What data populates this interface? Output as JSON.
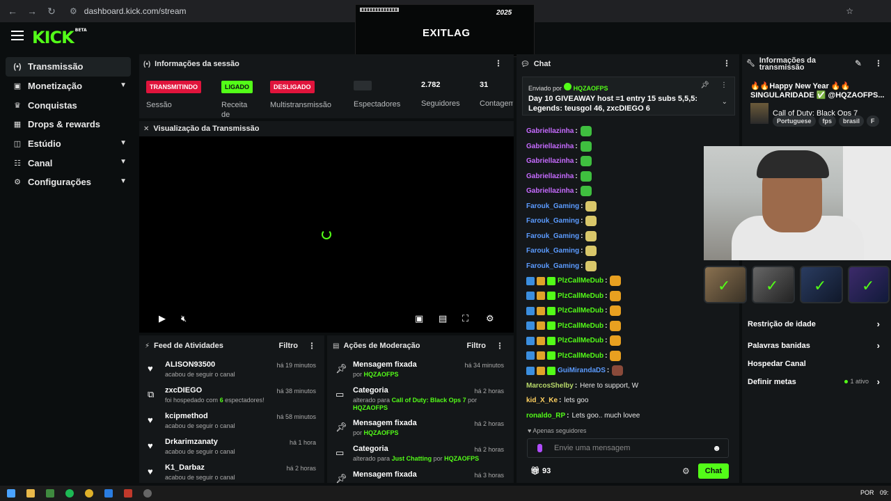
{
  "browser": {
    "url": "dashboard.kick.com/stream"
  },
  "overlay": {
    "brand": "EXITLAG",
    "year": "2025"
  },
  "header": {
    "logo": "KICK",
    "logo_tag": "BETA"
  },
  "sidebar": {
    "items": [
      {
        "label": "Transmissão",
        "icon": "broadcast-icon"
      },
      {
        "label": "Monetização",
        "icon": "monetization-icon"
      },
      {
        "label": "Conquistas",
        "icon": "trophy-icon"
      },
      {
        "label": "Drops & rewards",
        "icon": "drops-icon"
      },
      {
        "label": "Estúdio",
        "icon": "studio-icon"
      },
      {
        "label": "Canal",
        "icon": "channel-icon"
      },
      {
        "label": "Configurações",
        "icon": "gear-icon"
      }
    ]
  },
  "session": {
    "title": "Informações da sessão",
    "stats": [
      {
        "badge": "TRANSMITINDO",
        "label": "Sessão"
      },
      {
        "badge": "LIGADO",
        "label": "Receita de"
      },
      {
        "badge": "DESLIGADO",
        "label": "Multistransmissão"
      },
      {
        "value": "",
        "label": "Espectadores"
      },
      {
        "value": "2.782",
        "label": "Seguidores"
      },
      {
        "value": "31",
        "label": "Contagem de"
      }
    ]
  },
  "viz": {
    "title": "Visualização da Transmissão"
  },
  "feed": {
    "title": "Feed de Atividades",
    "filter": "Filtro",
    "rows": [
      {
        "name": "ALISON93500",
        "sub": "acabou de seguir o canal",
        "time": "há 19 minutos",
        "icon": "heart-icon"
      },
      {
        "name": "zxcDIEGO",
        "sub_pre": "foi hospedado com",
        "sub_num": "6",
        "sub_post": "espectadores!",
        "time": "há 38 minutos",
        "icon": "host-icon"
      },
      {
        "name": "kcipmethod",
        "sub": "acabou de seguir o canal",
        "time": "há 58 minutos",
        "icon": "heart-icon"
      },
      {
        "name": "Drkarimzanaty",
        "sub": "acabou de seguir o canal",
        "time": "há 1 hora",
        "icon": "heart-icon"
      },
      {
        "name": "K1_Darbaz",
        "sub": "acabou de seguir o canal",
        "time": "há 2 horas",
        "icon": "heart-icon"
      }
    ]
  },
  "mod": {
    "title": "Ações de Moderação",
    "filter": "Filtro",
    "rows": [
      {
        "name": "Mensagem fixada",
        "sub_pre": "por",
        "sub_hl": "HQZAOFPS",
        "time": "há 34 minutos",
        "icon": "pin-icon"
      },
      {
        "name": "Categoria",
        "sub_pre": "alterado para",
        "sub_hl": "Call of Duty: Black Ops 7",
        "sub_mid": "por",
        "sub_hl2": "HQZAOFPS",
        "time": "há 2 horas",
        "icon": "category-icon"
      },
      {
        "name": "Mensagem fixada",
        "sub_pre": "por",
        "sub_hl": "HQZAOFPS",
        "time": "há 2 horas",
        "icon": "pin-icon"
      },
      {
        "name": "Categoria",
        "sub_pre": "alterado para",
        "sub_hl": "Just Chatting",
        "sub_mid": "por",
        "sub_hl2": "HQZAOFPS",
        "time": "há 2 horas",
        "icon": "category-icon"
      },
      {
        "name": "Mensagem fixada",
        "sub_pre": "",
        "sub_hl": "",
        "time": "há 3 horas",
        "icon": "pin-icon"
      }
    ]
  },
  "chat": {
    "title": "Chat",
    "pinned": {
      "by_label": "Enviado por",
      "by_user": "HQZAOFPS",
      "message": "Day 10 GIVEAWAY host =1 entry 15 subs 5,5,5: Legends: teusgol 46, zxcDIEGO 6"
    },
    "messages": [
      {
        "user": "Gabriellazinha",
        "color": "#c66bff"
      },
      {
        "user": "Gabriellazinha",
        "color": "#c66bff"
      },
      {
        "user": "Gabriellazinha",
        "color": "#c66bff"
      },
      {
        "user": "Gabriellazinha",
        "color": "#c66bff"
      },
      {
        "user": "Gabriellazinha",
        "color": "#c66bff"
      },
      {
        "user": "Farouk_Gaming",
        "color": "#5b9bff"
      },
      {
        "user": "Farouk_Gaming",
        "color": "#5b9bff"
      },
      {
        "user": "Farouk_Gaming",
        "color": "#5b9bff"
      },
      {
        "user": "Farouk_Gaming",
        "color": "#5b9bff"
      },
      {
        "user": "Farouk_Gaming",
        "color": "#5b9bff"
      },
      {
        "user": "PlzCallMeDub",
        "color": "#53fc18"
      },
      {
        "user": "PlzCallMeDub",
        "color": "#53fc18"
      },
      {
        "user": "PlzCallMeDub",
        "color": "#53fc18"
      },
      {
        "user": "PlzCallMeDub",
        "color": "#53fc18"
      },
      {
        "user": "PlzCallMeDub",
        "color": "#53fc18"
      },
      {
        "user": "PlzCallMeDub",
        "color": "#53fc18"
      },
      {
        "user": "GuiMirandaDS",
        "color": "#5b9bff"
      },
      {
        "user": "MarcosShelby",
        "color": "#b9d96a",
        "text": "Here to support, W"
      },
      {
        "user": "kid_X_Ke",
        "color": "#ffd060",
        "text": "lets goo"
      },
      {
        "user": "ronaldo_RP",
        "color": "#53fc18",
        "text": "Lets goo.. much lovee"
      }
    ],
    "followers_only": "Apenas seguidores",
    "input_placeholder": "Envie uma mensagem",
    "points": "93",
    "send_label": "Chat"
  },
  "info": {
    "title": "Informações da transmissão",
    "stream_title": "🔥🔥Happy New Year 🔥🔥 SINGULARIDADE ✅ @HQZAOFPS...",
    "category": "Call of Duty: Black Ops 7",
    "tags": [
      "Portuguese",
      "fps",
      "brasil",
      "F"
    ],
    "settings": [
      {
        "label": "Restrição de idade"
      },
      {
        "label": "Palavras banidas"
      },
      {
        "label": "Hospedar Canal"
      },
      {
        "label": "Definir metas",
        "meta": "1 ativo"
      }
    ]
  },
  "taskbar": {
    "lang": "POR",
    "clock": "09:"
  },
  "colors": {
    "accent": "#53fc18",
    "danger": "#e0143c",
    "bg": "#0b0e0f",
    "panel": "#141719"
  }
}
